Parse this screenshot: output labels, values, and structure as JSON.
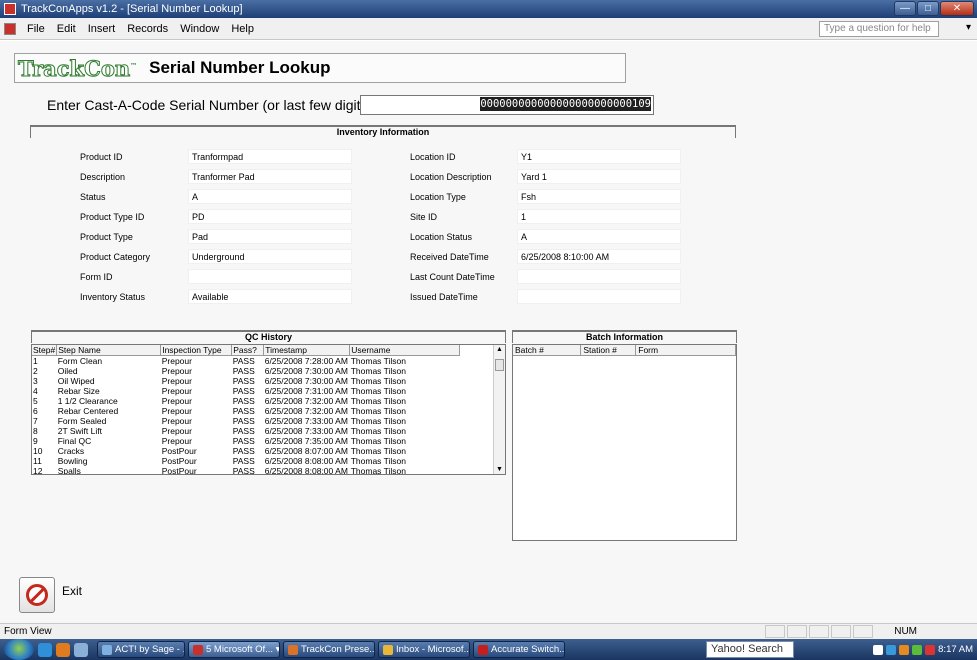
{
  "window": {
    "title": "TrackConApps v1.2 - [Serial Number Lookup]",
    "controls": [
      "—",
      "□",
      "✕"
    ]
  },
  "menubar": {
    "items": [
      {
        "label": "File"
      },
      {
        "label": "Edit"
      },
      {
        "label": "Insert"
      },
      {
        "label": "Records"
      },
      {
        "label": "Window"
      },
      {
        "label": "Help"
      }
    ],
    "help_placeholder": "Type a question for help",
    "help_arrow": "▾"
  },
  "header": {
    "logo": "TrackCon",
    "logo_tm": "™",
    "title": "Serial Number Lookup"
  },
  "serial": {
    "label": "Enter Cast-A-Code Serial Number (or last  few digits):",
    "value": "000000000000000000000000109"
  },
  "inventory": {
    "heading": "Inventory Information",
    "left": [
      {
        "label": "Product ID",
        "value": "Tranformpad"
      },
      {
        "label": "Description",
        "value": "Tranformer Pad"
      },
      {
        "label": "Status",
        "value": "A"
      },
      {
        "label": "Product Type ID",
        "value": "PD"
      },
      {
        "label": "Product Type",
        "value": "Pad"
      },
      {
        "label": "Product Category",
        "value": "Underground"
      },
      {
        "label": "Form ID",
        "value": ""
      },
      {
        "label": "Inventory Status",
        "value": "Available"
      }
    ],
    "right": [
      {
        "label": "Location ID",
        "value": "Y1"
      },
      {
        "label": "Location Description",
        "value": "Yard 1"
      },
      {
        "label": "Location Type",
        "value": "Fsh"
      },
      {
        "label": "Site ID",
        "value": "1"
      },
      {
        "label": "Location Status",
        "value": "A"
      },
      {
        "label": "Received DateTime",
        "value": "6/25/2008 8:10:00 AM"
      },
      {
        "label": "Last Count DateTime",
        "value": ""
      },
      {
        "label": "Issued DateTime",
        "value": ""
      }
    ]
  },
  "qc": {
    "heading": "QC History",
    "columns": [
      "Step#",
      "Step Name",
      "Inspection Type",
      "Pass?",
      "Timestamp",
      "Username"
    ],
    "rows": [
      [
        "1",
        "Form Clean",
        "Prepour",
        "PASS",
        "6/25/2008 7:28:00 AM",
        "Thomas Tilson"
      ],
      [
        "2",
        "Oiled",
        "Prepour",
        "PASS",
        "6/25/2008 7:30:00 AM",
        "Thomas Tilson"
      ],
      [
        "3",
        "Oil Wiped",
        "Prepour",
        "PASS",
        "6/25/2008 7:30:00 AM",
        "Thomas Tilson"
      ],
      [
        "4",
        "Rebar Size",
        "Prepour",
        "PASS",
        "6/25/2008 7:31:00 AM",
        "Thomas Tilson"
      ],
      [
        "5",
        "1 1/2 Clearance",
        "Prepour",
        "PASS",
        "6/25/2008 7:32:00 AM",
        "Thomas Tilson"
      ],
      [
        "6",
        "Rebar Centered",
        "Prepour",
        "PASS",
        "6/25/2008 7:32:00 AM",
        "Thomas Tilson"
      ],
      [
        "7",
        "Form Sealed",
        "Prepour",
        "PASS",
        "6/25/2008 7:33:00 AM",
        "Thomas Tilson"
      ],
      [
        "8",
        "2T Swift Lift",
        "Prepour",
        "PASS",
        "6/25/2008 7:33:00 AM",
        "Thomas Tilson"
      ],
      [
        "9",
        "Final QC",
        "Prepour",
        "PASS",
        "6/25/2008 7:35:00 AM",
        "Thomas Tilson"
      ],
      [
        "10",
        "Cracks",
        "PostPour",
        "PASS",
        "6/25/2008 8:07:00 AM",
        "Thomas Tilson"
      ],
      [
        "11",
        "Bowling",
        "PostPour",
        "PASS",
        "6/25/2008 8:08:00 AM",
        "Thomas Tilson"
      ],
      [
        "12",
        "Spalls",
        "PostPour",
        "PASS",
        "6/25/2008 8:08:00 AM",
        "Thomas Tilson"
      ]
    ]
  },
  "batch": {
    "heading": "Batch Information",
    "columns": [
      "Batch #",
      "Station #",
      "Form"
    ]
  },
  "exit": {
    "label": "Exit"
  },
  "statusbar": {
    "left": "Form View",
    "num": "NUM"
  },
  "taskbar": {
    "tasks": [
      {
        "label": "ACT! by Sage - ...",
        "color": "#7fb0e0"
      },
      {
        "label": "5 Microsoft Of... ▾",
        "color": "#c9302c",
        "active": true
      },
      {
        "label": "TrackCon Prese...",
        "color": "#d9722a"
      },
      {
        "label": "Inbox - Microsof...",
        "color": "#e8b73a"
      },
      {
        "label": "Accurate Switch...",
        "color": "#c41e1e"
      }
    ],
    "search": "Yahoo! Search",
    "clock": "8:17 AM"
  }
}
